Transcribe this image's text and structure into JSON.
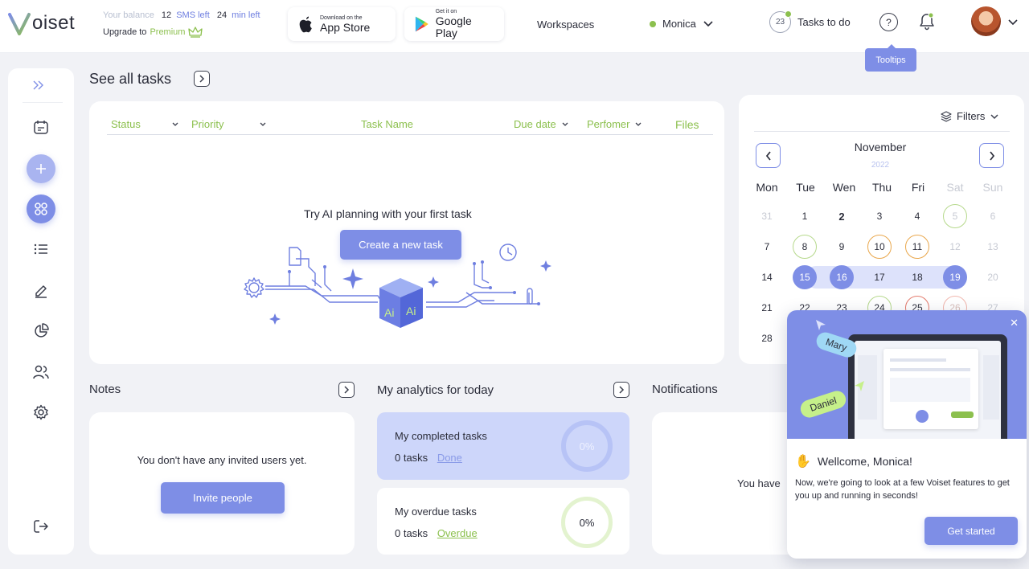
{
  "header": {
    "logo": "oiset",
    "balance_label": "Your balance",
    "sms_count": "12",
    "sms_label": "SMS left",
    "min_count": "24",
    "min_label": "min left",
    "upgrade_label": "Upgrade to",
    "premium_label": "Premium",
    "app_store_small": "Download on the",
    "app_store_big": "App Store",
    "play_small": "Get it on",
    "play_big": "Google Play",
    "workspaces": "Workspaces",
    "user": "Monica",
    "tasks_count": "23",
    "tasks_label": "Tasks to do",
    "help": "?",
    "tooltip": "Tooltips"
  },
  "tasks": {
    "title": "See all tasks",
    "columns": {
      "status": "Status",
      "priority": "Priority",
      "name": "Task Name",
      "due": "Due date",
      "performer": "Perfomer",
      "files": "Files"
    },
    "empty_title": "Try AI planning with your first task",
    "create_button": "Create a new task",
    "illustration_label": "Ai"
  },
  "calendar": {
    "filters_label": "Filters",
    "month": "November",
    "year": "2022",
    "weekdays": [
      "Mon",
      "Tue",
      "Wen",
      "Thu",
      "Fri",
      "Sat",
      "Sun"
    ],
    "days": [
      "31",
      "1",
      "2",
      "3",
      "4",
      "5",
      "6",
      "7",
      "8",
      "9",
      "10",
      "11",
      "12",
      "13",
      "14",
      "15",
      "16",
      "17",
      "18",
      "19",
      "20",
      "21",
      "22",
      "23",
      "24",
      "25",
      "26",
      "27",
      "28"
    ]
  },
  "notes": {
    "title": "Notes",
    "empty_text": "You don't have any invited users yet.",
    "invite_button": "Invite people"
  },
  "analytics": {
    "title": "My analytics for today",
    "completed_title": "My completed tasks",
    "completed_count": "0 tasks",
    "completed_link": "Done",
    "completed_percent": "0%",
    "overdue_title": "My overdue tasks",
    "overdue_count": "0 tasks",
    "overdue_link": "Overdue",
    "overdue_percent": "0%"
  },
  "notifications": {
    "title": "Notifications",
    "partial_text": "You have"
  },
  "welcome": {
    "tag_1": "Mary",
    "tag_2": "Daniel",
    "title": "Wellcome, Monica!",
    "text": "Now, we're going to look at a few Voiset features to get you up and running in seconds!",
    "button": "Get started"
  },
  "colors": {
    "accent": "#7e8ee6",
    "green": "#8cc04e",
    "light_accent": "#dde2fb"
  }
}
